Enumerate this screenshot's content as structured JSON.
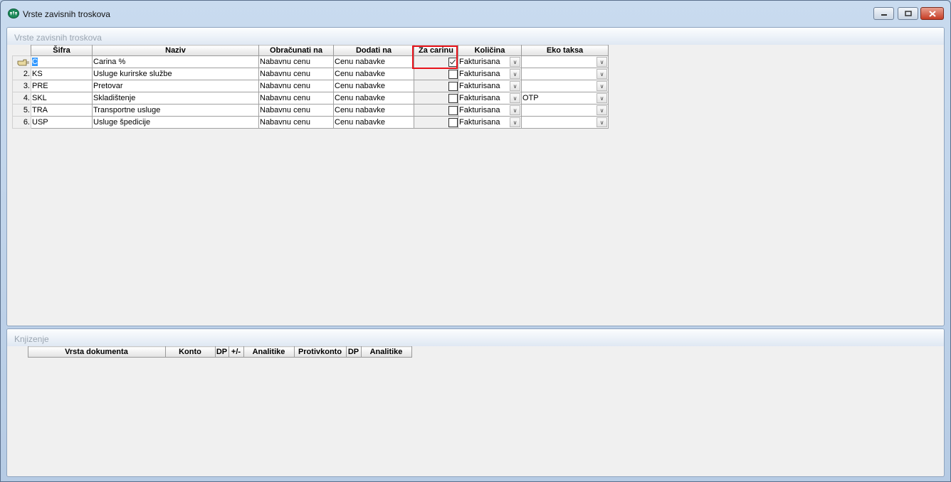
{
  "window": {
    "title": "Vrste zavisnih troskova"
  },
  "panel_top": {
    "title": "Vrste zavisnih troskova",
    "columns": [
      "Šifra",
      "Naziv",
      "Obračunati na",
      "Dodati na",
      "Za carinu",
      "Količina",
      "Eko taksa"
    ],
    "rows": [
      {
        "num": "1.",
        "sifra": "C",
        "naziv": "Carina %",
        "obracunati": "Nabavnu cenu",
        "dodati": "Cenu nabavke",
        "za_carinu": true,
        "kolicina": "Fakturisana",
        "eko": ""
      },
      {
        "num": "2.",
        "sifra": "KS",
        "naziv": "Usluge kurirske službe",
        "obracunati": "Nabavnu cenu",
        "dodati": "Cenu nabavke",
        "za_carinu": false,
        "kolicina": "Fakturisana",
        "eko": ""
      },
      {
        "num": "3.",
        "sifra": "PRE",
        "naziv": "Pretovar",
        "obracunati": "Nabavnu cenu",
        "dodati": "Cenu nabavke",
        "za_carinu": false,
        "kolicina": "Fakturisana",
        "eko": ""
      },
      {
        "num": "4.",
        "sifra": "SKL",
        "naziv": "Skladištenje",
        "obracunati": "Nabavnu cenu",
        "dodati": "Cenu nabavke",
        "za_carinu": false,
        "kolicina": "Fakturisana",
        "eko": "OTP"
      },
      {
        "num": "5.",
        "sifra": "TRA",
        "naziv": "Transportne usluge",
        "obracunati": "Nabavnu cenu",
        "dodati": "Cenu nabavke",
        "za_carinu": false,
        "kolicina": "Fakturisana",
        "eko": ""
      },
      {
        "num": "6.",
        "sifra": "USP",
        "naziv": "Usluge špedicije",
        "obracunati": "Nabavnu cenu",
        "dodati": "Cenu nabavke",
        "za_carinu": false,
        "kolicina": "Fakturisana",
        "eko": ""
      }
    ]
  },
  "panel_bottom": {
    "title": "Knjizenje",
    "columns": [
      "Vrsta dokumenta",
      "Konto",
      "DP",
      "+/-",
      "Analitike",
      "Protivkonto",
      "DP",
      "Analitike"
    ]
  },
  "colors": {
    "highlight": "#e8141c",
    "selection": "#3399ff"
  },
  "icons": {
    "row_pointer": "hand-pointer-icon",
    "dropdown": "chevron-down-icon"
  }
}
